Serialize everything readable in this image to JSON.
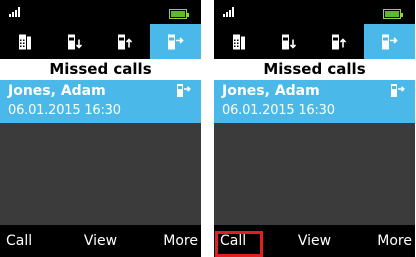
{
  "screens": [
    {
      "header_title": "Missed calls",
      "tabs": [
        {
          "icon": "phone-book-icon",
          "active": false
        },
        {
          "icon": "received-calls-icon",
          "active": false
        },
        {
          "icon": "dialed-calls-icon",
          "active": false
        },
        {
          "icon": "missed-calls-icon",
          "active": true
        }
      ],
      "call": {
        "name": "Jones, Adam",
        "datetime": "06.01.2015 16:30",
        "icon": "missed-call-icon"
      },
      "softkeys": {
        "left": "Call",
        "center": "View",
        "right": "More"
      },
      "highlight_left_softkey": false
    },
    {
      "header_title": "Missed calls",
      "tabs": [
        {
          "icon": "phone-book-icon",
          "active": false
        },
        {
          "icon": "received-calls-icon",
          "active": false
        },
        {
          "icon": "dialed-calls-icon",
          "active": false
        },
        {
          "icon": "missed-calls-icon",
          "active": true
        }
      ],
      "call": {
        "name": "Jones, Adam",
        "datetime": "06.01.2015 16:30",
        "icon": "missed-call-icon"
      },
      "softkeys": {
        "left": "Call",
        "center": "View",
        "right": "More"
      },
      "highlight_left_softkey": true
    }
  ],
  "colors": {
    "accent": "#4ab8e8",
    "battery": "#5dbb2a",
    "highlight": "#e02020"
  }
}
